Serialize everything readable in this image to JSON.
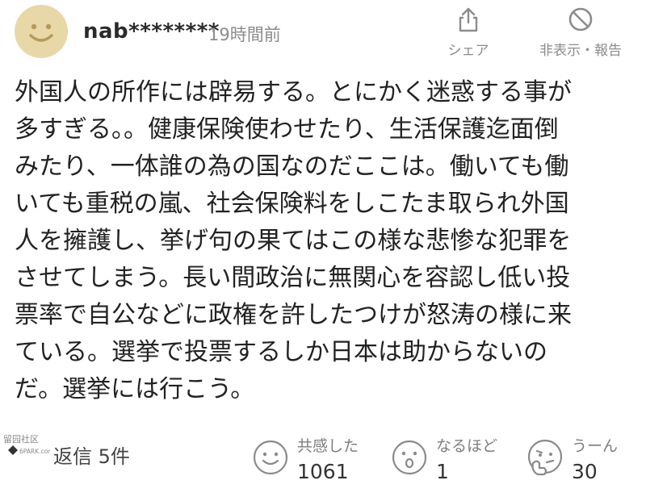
{
  "comment": {
    "username": "nab********",
    "timestamp": "19時間前",
    "avatar_color": "#e8d8a8",
    "avatar_face_color": "#b89a58",
    "share_label": "シェア",
    "hide_report_label": "非表示・報告",
    "body": "外国人の所作には辟易する。とにかく迷惑する事が\n多すぎる。。健康保険使わせたり、生活保護迄面倒\nみたり、一体誰の為の国なのだここは。働いても働\nいても重税の嵐、社会保険料をしこたま取られ外国\n人を擁護し、挙げ句の果てはこの様な悲惨な犯罪を\nさせてしまう。長い間政治に無関心を容認し低い投\n票率で自公などに政権を許したつけが怒涛の様に来\nている。選挙で投票するしか日本は助からないの\nだ。選挙には行こう。",
    "watermark_text": "留园社区",
    "watermark_subtext": "6PARK.com",
    "reply_label": "返信 5件",
    "reactions": [
      {
        "icon": "smile-face-icon",
        "label": "共感した",
        "count": "1061"
      },
      {
        "icon": "surprised-face-icon",
        "label": "なるほど",
        "count": "1"
      },
      {
        "icon": "thinking-face-icon",
        "label": "うーん",
        "count": "30"
      }
    ]
  }
}
